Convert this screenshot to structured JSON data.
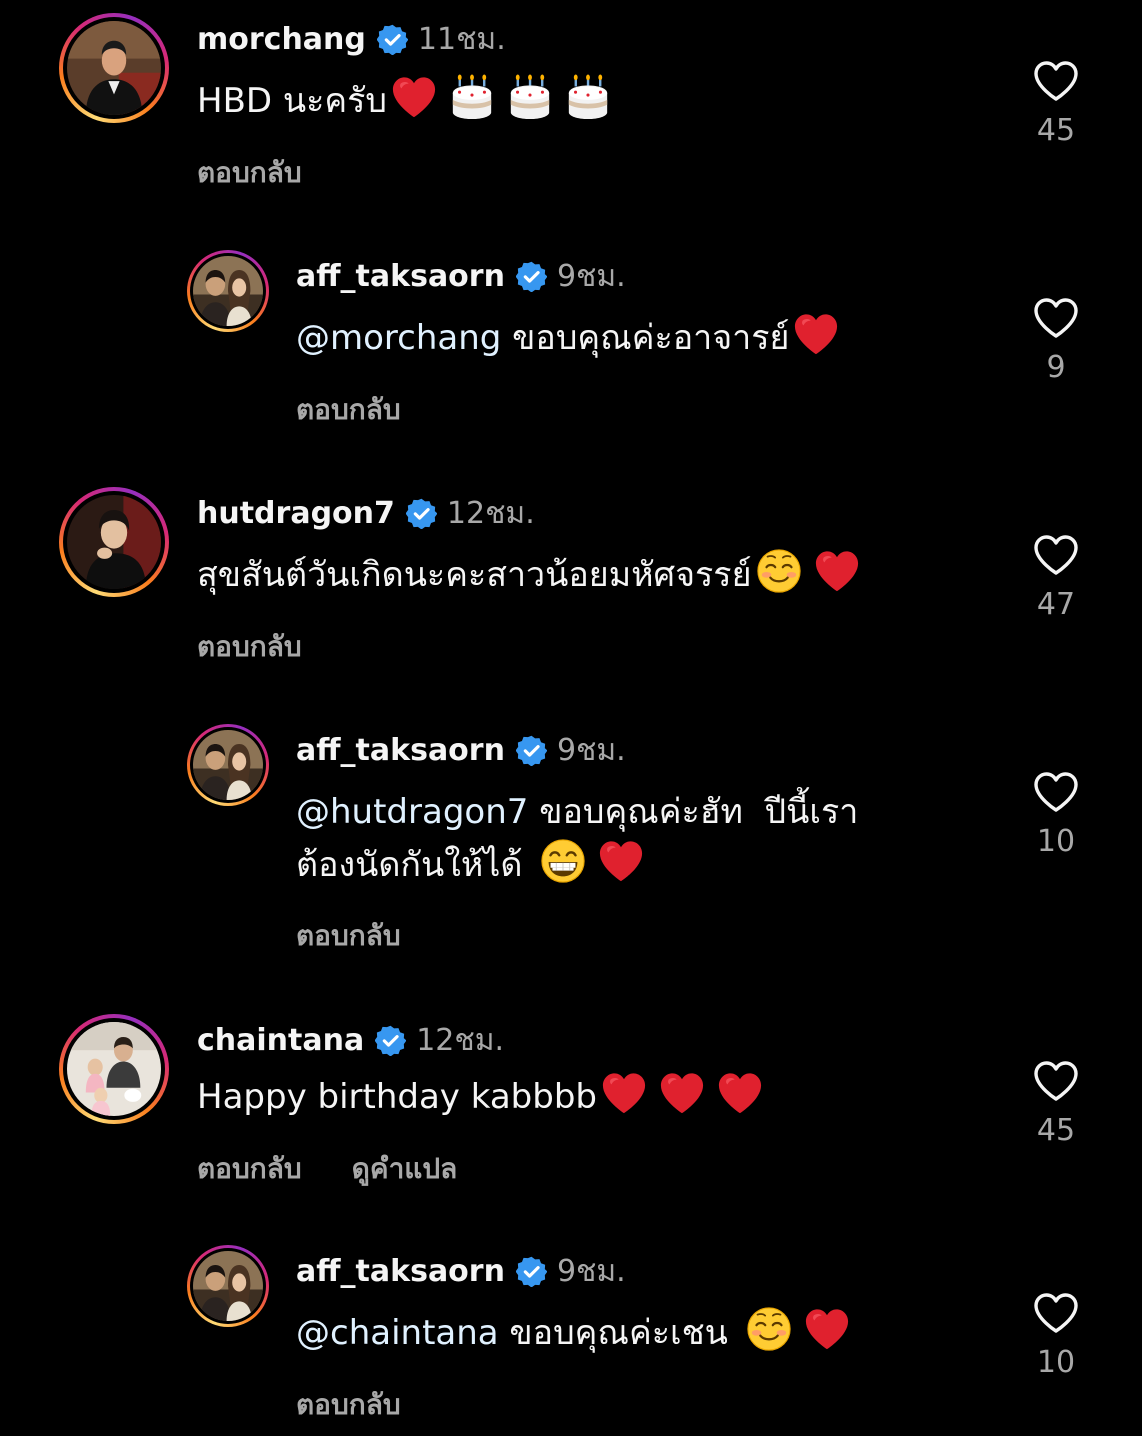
{
  "colors": {
    "background": "#000000",
    "text_primary": "#f5f5f5",
    "text_secondary": "#a8a8a8",
    "verified_badge": "#3797f0",
    "heart_emoji": "#e0212e"
  },
  "comments": [
    {
      "username": "morchang",
      "verified": true,
      "timestamp": "11ชม.",
      "text": "HBD นะครับ",
      "emojis": [
        "red-heart",
        "birthday-cake",
        "birthday-cake",
        "birthday-cake"
      ],
      "reply_label": "ตอบกลับ",
      "like_count": "45",
      "avatar_icon": "profile-photo-morchang"
    },
    {
      "username": "aff_taksaorn",
      "verified": true,
      "timestamp": "9ชม.",
      "mention": "@morchang",
      "text": " ขอบคุณค่ะอาจารย์",
      "emojis": [
        "red-heart"
      ],
      "reply_label": "ตอบกลับ",
      "like_count": "9",
      "avatar_icon": "profile-photo-aff-taksaorn"
    },
    {
      "username": "hutdragon7",
      "verified": true,
      "timestamp": "12ชม.",
      "text": "สุขสันต์วันเกิดนะคะสาวน้อยมหัศจรรย์",
      "emojis": [
        "smiling-face",
        "red-heart"
      ],
      "reply_label": "ตอบกลับ",
      "like_count": "47",
      "avatar_icon": "profile-photo-hutdragon7"
    },
    {
      "username": "aff_taksaorn",
      "verified": true,
      "timestamp": "9ชม.",
      "mention": "@hutdragon7",
      "text": " ขอบคุณค่ะฮัท  ปีนี้เรา",
      "text_line2": "ต้องนัดกันให้ได้",
      "emojis": [
        "grinning-face",
        "red-heart"
      ],
      "reply_label": "ตอบกลับ",
      "like_count": "10",
      "avatar_icon": "profile-photo-aff-taksaorn"
    },
    {
      "username": "chaintana",
      "verified": true,
      "timestamp": "12ชม.",
      "text": "Happy birthday kabbbb",
      "emojis": [
        "red-heart",
        "red-heart",
        "red-heart"
      ],
      "reply_label": "ตอบกลับ",
      "translate_label": "ดูคำแปล",
      "like_count": "45",
      "avatar_icon": "profile-photo-chaintana"
    },
    {
      "username": "aff_taksaorn",
      "verified": true,
      "timestamp": "9ชม.",
      "mention": "@chaintana",
      "text": " ขอบคุณค่ะเชน",
      "emojis": [
        "smiling-face",
        "red-heart"
      ],
      "reply_label": "ตอบกลับ",
      "like_count": "10",
      "avatar_icon": "profile-photo-aff-taksaorn"
    }
  ]
}
